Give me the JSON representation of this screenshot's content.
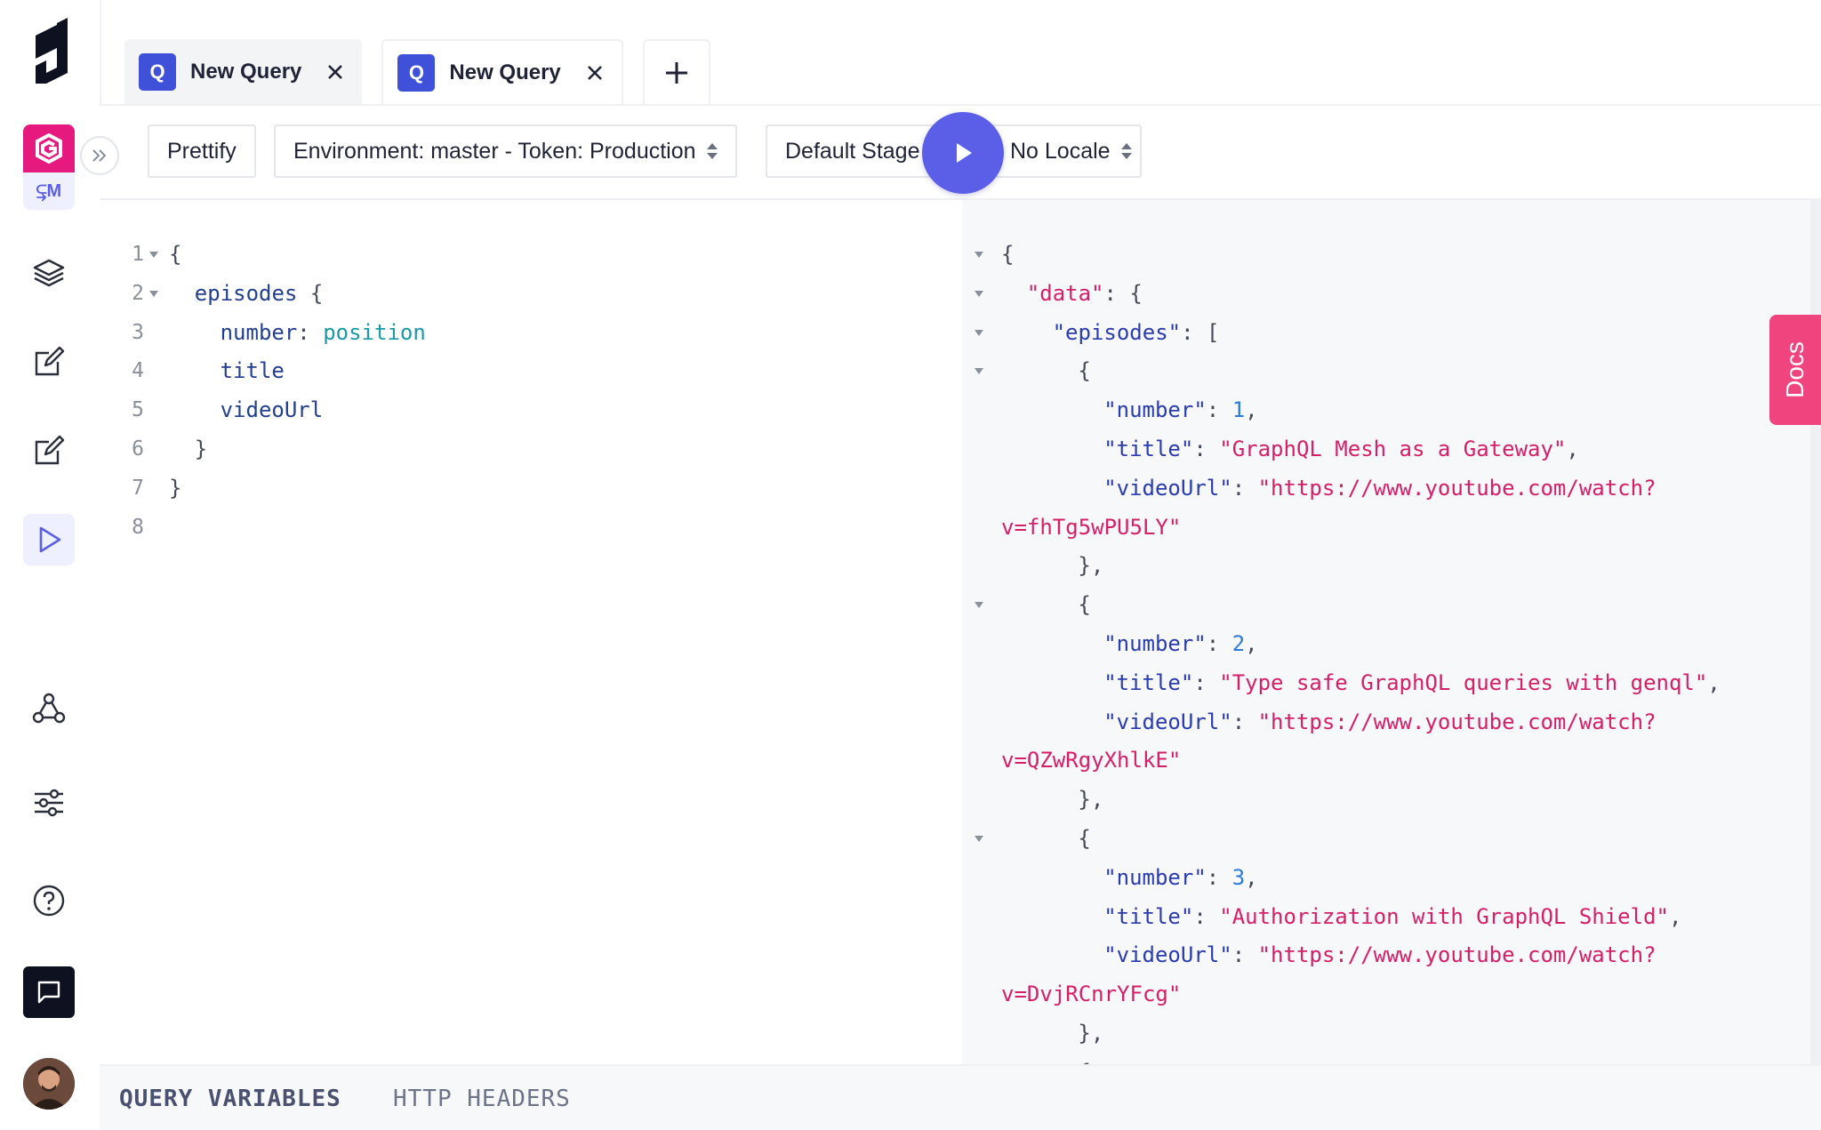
{
  "tabs": [
    {
      "badge": "Q",
      "label": "New Query"
    },
    {
      "badge": "Q",
      "label": "New Query"
    }
  ],
  "rail": {
    "project_env": "⥹M",
    "icons": [
      "schema-icon",
      "content-edit-icon",
      "content-edit-icon",
      "playground-icon",
      "webhooks-icon",
      "settings-icon",
      "help-icon",
      "chat-icon"
    ]
  },
  "toolbar": {
    "prettify": "Prettify",
    "environment": "Environment: master - Token: Production",
    "stage": "Default Stage",
    "locale": "No Locale"
  },
  "query_lines": [
    {
      "n": "1",
      "fold": true,
      "indent": 0,
      "parts": [
        [
          "{",
          "k-punct"
        ]
      ]
    },
    {
      "n": "2",
      "fold": true,
      "indent": 1,
      "parts": [
        [
          "episodes",
          "k-field"
        ],
        [
          " {",
          "k-punct"
        ]
      ]
    },
    {
      "n": "3",
      "fold": false,
      "indent": 2,
      "parts": [
        [
          "number",
          "k-alias"
        ],
        [
          ": ",
          "k-punct"
        ],
        [
          "position",
          "k-target"
        ]
      ]
    },
    {
      "n": "4",
      "fold": false,
      "indent": 2,
      "parts": [
        [
          "title",
          "k-field"
        ]
      ]
    },
    {
      "n": "5",
      "fold": false,
      "indent": 2,
      "parts": [
        [
          "videoUrl",
          "k-field"
        ]
      ]
    },
    {
      "n": "6",
      "fold": false,
      "indent": 1,
      "parts": [
        [
          "}",
          "k-punct"
        ]
      ]
    },
    {
      "n": "7",
      "fold": false,
      "indent": 0,
      "parts": [
        [
          "}",
          "k-punct"
        ]
      ]
    },
    {
      "n": "8",
      "fold": false,
      "indent": 0,
      "parts": []
    }
  ],
  "result_lines": [
    {
      "fold": true,
      "indent": 0,
      "parts": [
        [
          "{",
          "k-punct"
        ]
      ]
    },
    {
      "fold": true,
      "indent": 1,
      "parts": [
        [
          "\"data\"",
          "j-key-data"
        ],
        [
          ": {",
          "k-punct"
        ]
      ]
    },
    {
      "fold": true,
      "indent": 2,
      "parts": [
        [
          "\"episodes\"",
          "j-key"
        ],
        [
          ": [",
          "k-punct"
        ]
      ]
    },
    {
      "fold": true,
      "indent": 3,
      "parts": [
        [
          "{",
          "k-punct"
        ]
      ]
    },
    {
      "fold": false,
      "indent": 4,
      "parts": [
        [
          "\"number\"",
          "j-key"
        ],
        [
          ": ",
          "k-punct"
        ],
        [
          "1",
          "j-num"
        ],
        [
          ",",
          "k-punct"
        ]
      ]
    },
    {
      "fold": false,
      "indent": 4,
      "parts": [
        [
          "\"title\"",
          "j-key"
        ],
        [
          ": ",
          "k-punct"
        ],
        [
          "\"GraphQL Mesh as a Gateway\"",
          "j-str"
        ],
        [
          ",",
          "k-punct"
        ]
      ]
    },
    {
      "fold": false,
      "indent": 4,
      "parts": [
        [
          "\"videoUrl\"",
          "j-key"
        ],
        [
          ": ",
          "k-punct"
        ],
        [
          "\"https://www.youtube.com/watch?",
          "j-str"
        ]
      ]
    },
    {
      "fold": false,
      "indent": 0,
      "parts": [
        [
          "v=fhTg5wPU5LY\"",
          "j-str"
        ]
      ]
    },
    {
      "fold": false,
      "indent": 3,
      "parts": [
        [
          "},",
          "k-punct"
        ]
      ]
    },
    {
      "fold": true,
      "indent": 3,
      "parts": [
        [
          "{",
          "k-punct"
        ]
      ]
    },
    {
      "fold": false,
      "indent": 4,
      "parts": [
        [
          "\"number\"",
          "j-key"
        ],
        [
          ": ",
          "k-punct"
        ],
        [
          "2",
          "j-num"
        ],
        [
          ",",
          "k-punct"
        ]
      ]
    },
    {
      "fold": false,
      "indent": 4,
      "parts": [
        [
          "\"title\"",
          "j-key"
        ],
        [
          ": ",
          "k-punct"
        ],
        [
          "\"Type safe GraphQL queries with genql\"",
          "j-str"
        ],
        [
          ",",
          "k-punct"
        ]
      ]
    },
    {
      "fold": false,
      "indent": 4,
      "parts": [
        [
          "\"videoUrl\"",
          "j-key"
        ],
        [
          ": ",
          "k-punct"
        ],
        [
          "\"https://www.youtube.com/watch?",
          "j-str"
        ]
      ]
    },
    {
      "fold": false,
      "indent": 0,
      "parts": [
        [
          "v=QZwRgyXhlkE\"",
          "j-str"
        ]
      ]
    },
    {
      "fold": false,
      "indent": 3,
      "parts": [
        [
          "},",
          "k-punct"
        ]
      ]
    },
    {
      "fold": true,
      "indent": 3,
      "parts": [
        [
          "{",
          "k-punct"
        ]
      ]
    },
    {
      "fold": false,
      "indent": 4,
      "parts": [
        [
          "\"number\"",
          "j-key"
        ],
        [
          ": ",
          "k-punct"
        ],
        [
          "3",
          "j-num"
        ],
        [
          ",",
          "k-punct"
        ]
      ]
    },
    {
      "fold": false,
      "indent": 4,
      "parts": [
        [
          "\"title\"",
          "j-key"
        ],
        [
          ": ",
          "k-punct"
        ],
        [
          "\"Authorization with GraphQL Shield\"",
          "j-str"
        ],
        [
          ",",
          "k-punct"
        ]
      ]
    },
    {
      "fold": false,
      "indent": 4,
      "parts": [
        [
          "\"videoUrl\"",
          "j-key"
        ],
        [
          ": ",
          "k-punct"
        ],
        [
          "\"https://www.youtube.com/watch?",
          "j-str"
        ]
      ]
    },
    {
      "fold": false,
      "indent": 0,
      "parts": [
        [
          "v=DvjRCnrYFcg\"",
          "j-str"
        ]
      ]
    },
    {
      "fold": false,
      "indent": 3,
      "parts": [
        [
          "},",
          "k-punct"
        ]
      ]
    },
    {
      "fold": true,
      "indent": 3,
      "parts": [
        [
          "{",
          "k-punct"
        ]
      ]
    }
  ],
  "docs_label": "Docs",
  "bottom_tabs": {
    "variables": "QUERY VARIABLES",
    "headers": "HTTP HEADERS"
  },
  "colors": {
    "accent": "#5b5fe8",
    "brand_pink": "#e6197f",
    "docs_pink": "#f0447e",
    "tab_badge": "#3f51d8"
  }
}
